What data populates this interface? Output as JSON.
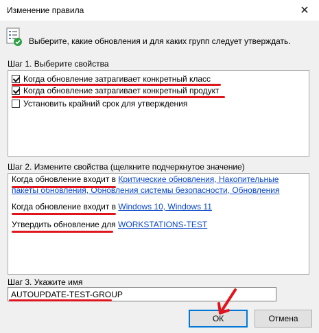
{
  "window": {
    "title": "Изменение правила",
    "close_icon": "close-icon"
  },
  "intro": {
    "text": "Выберите, какие обновления и для каких групп следует утверждать.",
    "icon": "checklist-icon"
  },
  "step1": {
    "label": "Шаг 1. Выберите свойства",
    "items": [
      {
        "label": "Когда обновление затрагивает конкретный класс",
        "checked": true
      },
      {
        "label": "Когда обновление затрагивает конкретный продукт",
        "checked": true
      },
      {
        "label": "Установить крайний срок для утверждения",
        "checked": false
      }
    ]
  },
  "step2": {
    "label": "Шаг 2. Измените свойства (щелкните подчеркнутое значение)",
    "rule1": {
      "prefix": "Когда обновление входит в",
      "link_line1": "Критические обновления, Накопительные",
      "link_line2": "пакеты обновления, Обновления системы безопасности, Обновления"
    },
    "rule2": {
      "prefix": "Когда обновление входит в",
      "link": "Windows 10, Windows 11"
    },
    "rule3": {
      "prefix": "Утвердить обновление для",
      "link": "WORKSTATIONS-TEST"
    }
  },
  "step3": {
    "label": "Шаг 3. Укажите имя",
    "value": "AUTOUPDATE-TEST-GROUP"
  },
  "buttons": {
    "ok": "ОК",
    "cancel": "Отмена"
  },
  "colors": {
    "annotation": "#e0141c",
    "link": "#0a48c8",
    "accent": "#0078d7"
  }
}
